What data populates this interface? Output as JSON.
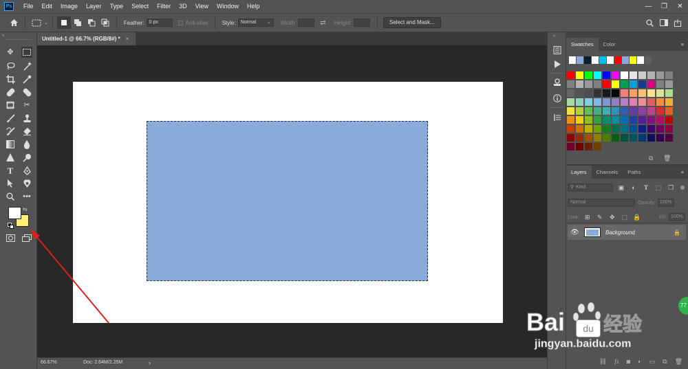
{
  "app": {
    "logo_text": "Ps"
  },
  "menu": [
    "File",
    "Edit",
    "Image",
    "Layer",
    "Type",
    "Select",
    "Filter",
    "3D",
    "View",
    "Window",
    "Help"
  ],
  "window_controls": {
    "minimize": "—",
    "restore": "❐",
    "close": "✕"
  },
  "options_bar": {
    "feather_label": "Feather:",
    "feather_value": "0 px",
    "antialias_label": "Anti-alias",
    "style_label": "Style:",
    "style_value": "Normal",
    "width_label": "Width:",
    "height_label": "Height:",
    "select_mask_button": "Select and Mask..."
  },
  "document_tab": {
    "title": "Untitled-1 @ 66.7% (RGB/8#) *",
    "close": "×"
  },
  "status_bar": {
    "zoom": "66.67%",
    "doc_info": "Doc: 2.64M/2.25M",
    "arrow": "›"
  },
  "colors": {
    "foreground": "#ffffff",
    "background": "#fff176",
    "selection_fill": "#8aabda",
    "annotation_arrow": "#e02020"
  },
  "swatches_panel": {
    "tabs": [
      "Swatches",
      "Color"
    ],
    "active_tab": "Swatches",
    "recent": [
      "#ffffff",
      "#8aabda",
      "#0a1e2c",
      "#ffffff",
      "#00c0f0",
      "#ffffff",
      "#ff0000",
      "#8aabda",
      "#ffff00",
      "#ffffff",
      "#606060"
    ],
    "grid": [
      "#ff0000",
      "#ffff00",
      "#00ff00",
      "#00ffff",
      "#0000ff",
      "#ff00ff",
      "#ffffff",
      "#e6e6e6",
      "#cccccc",
      "#b3b3b3",
      "#999999",
      "#808080",
      "#808080",
      "#b3b3b3",
      "#999999",
      "#808080",
      "#ff0000",
      "#ffff00",
      "#00a050",
      "#00a0e0",
      "#1a3a90",
      "#e0007f",
      "#808080",
      "#999999",
      "#666666",
      "#555555",
      "#4d4d4d",
      "#333333",
      "#1a1a1a",
      "#000000",
      "#f08080",
      "#f4a460",
      "#f5c07a",
      "#fde08a",
      "#d8e690",
      "#b0dc90",
      "#a8d8a0",
      "#90d4c0",
      "#80ccd8",
      "#80b8e0",
      "#8098d0",
      "#9080c0",
      "#b080c0",
      "#e080b0",
      "#e89090",
      "#e06060",
      "#f09040",
      "#f0b030",
      "#f0e040",
      "#b0d040",
      "#60c050",
      "#40b080",
      "#40b0b0",
      "#3090c0",
      "#3060b0",
      "#6040a0",
      "#9040a0",
      "#c04090",
      "#d83030",
      "#e86020",
      "#f09010",
      "#f0d000",
      "#90c020",
      "#30a040",
      "#009070",
      "#0090a0",
      "#0070b0",
      "#2040a0",
      "#502090",
      "#801080",
      "#b01060",
      "#c00000",
      "#c04000",
      "#d07000",
      "#c0b000",
      "#70a000",
      "#108020",
      "#007050",
      "#007080",
      "#005090",
      "#102080",
      "#400070",
      "#700060",
      "#900040",
      "#900000",
      "#903000",
      "#a05000",
      "#908000",
      "#508000",
      "#006010",
      "#005040",
      "#005060",
      "#003870",
      "#101060",
      "#300050",
      "#500040",
      "#700030",
      "#6b0000",
      "#6b2000",
      "#6b4000"
    ]
  },
  "layers_panel": {
    "tabs": [
      "Layers",
      "Channels",
      "Paths"
    ],
    "active_tab": "Layers",
    "kind_placeholder": "Kind",
    "blend_mode": "Normal",
    "opacity_label": "Opacity:",
    "opacity_value": "100%",
    "lock_label": "Lock:",
    "fill_label": "Fill:",
    "fill_value": "100%",
    "layers": [
      {
        "name": "Background",
        "visible": true,
        "locked": true
      }
    ]
  },
  "watermark": {
    "brand": "Bai",
    "brand_cn": "经验",
    "url": "jingyan.baidu.com",
    "badge": "77"
  }
}
